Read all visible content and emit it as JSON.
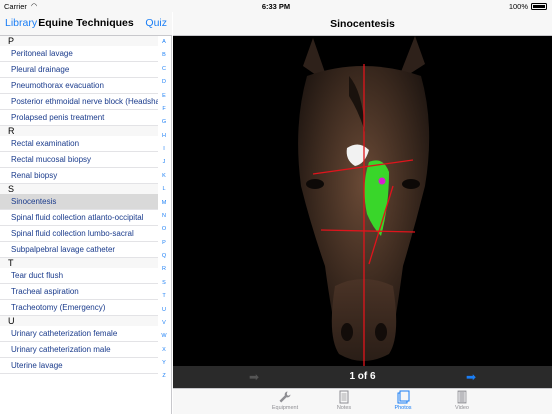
{
  "status": {
    "carrier": "Carrier",
    "time": "6:33 PM",
    "battery": "100%"
  },
  "master": {
    "back_label": "Library",
    "title": "Equine Techniques",
    "quiz_label": "Quiz",
    "sections": [
      {
        "letter": "P",
        "items": [
          "Peritoneal lavage",
          "Pleural drainage",
          "Pneumothorax evacuation",
          "Posterior ethmoidal nerve block (Headsha",
          "Prolapsed penis treatment"
        ]
      },
      {
        "letter": "R",
        "items": [
          "Rectal examination",
          "Rectal mucosal biopsy",
          "Renal biopsy"
        ]
      },
      {
        "letter": "S",
        "items": [
          "Sinocentesis",
          "Spinal fluid collection atlanto-occipital",
          "Spinal fluid collection lumbo-sacral",
          "Subpalpebral lavage catheter"
        ]
      },
      {
        "letter": "T",
        "items": [
          "Tear duct flush",
          "Tracheal aspiration",
          "Tracheotomy (Emergency)"
        ]
      },
      {
        "letter": "U",
        "items": [
          "Urinary catheterization female",
          "Urinary catheterization male",
          "Uterine lavage"
        ]
      }
    ],
    "selected": "Sinocentesis",
    "index_letters": [
      "A",
      "B",
      "C",
      "D",
      "E",
      "F",
      "G",
      "H",
      "I",
      "J",
      "K",
      "L",
      "M",
      "N",
      "O",
      "P",
      "Q",
      "R",
      "S",
      "T",
      "U",
      "V",
      "W",
      "X",
      "Y",
      "Z"
    ]
  },
  "detail": {
    "title": "Sinocentesis",
    "pager": "1 of 6",
    "tabs": [
      {
        "label": "Equipment",
        "icon": "wrench-icon"
      },
      {
        "label": "Notes",
        "icon": "notes-icon"
      },
      {
        "label": "Photos",
        "icon": "photos-icon",
        "active": true
      },
      {
        "label": "Video",
        "icon": "video-icon"
      }
    ],
    "colors": {
      "accent": "#1a7ef5",
      "sinus_overlay": "#39d62a",
      "marker": "#d61fd0",
      "guide_lines": "#e0141c"
    }
  }
}
